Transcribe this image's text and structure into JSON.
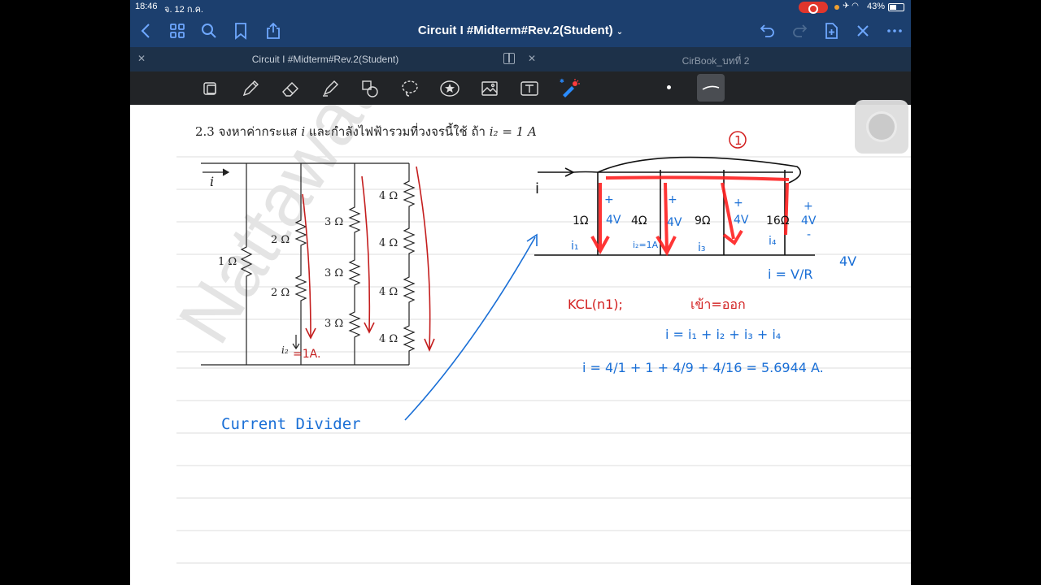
{
  "status_bar": {
    "time": "18:46",
    "date": "จ. 12 ก.ค.",
    "battery": "43%"
  },
  "nav": {
    "title": "Circuit I #Midterm#Rev.2(Student)",
    "icons": [
      "back-icon",
      "grid-icon",
      "search-icon",
      "bookmark-icon",
      "share-icon",
      "undo-icon",
      "redo-icon",
      "add-page-icon",
      "close-icon",
      "more-icon"
    ]
  },
  "tabs": [
    {
      "label": "Circuit I #Midterm#Rev.2(Student)",
      "active": true
    },
    {
      "label": "CirBook_บทที่ 2",
      "active": false
    }
  ],
  "toolbar": {
    "tools": [
      "read-mode-icon",
      "pen-icon",
      "eraser-icon",
      "highlighter-icon",
      "shapes-icon",
      "lasso-icon",
      "sticker-icon",
      "image-icon",
      "text-icon",
      "laser-pointer-icon"
    ],
    "selected_stroke": "thin-line"
  },
  "question": {
    "number": "2.3",
    "text": "จงหาค่ากระแส",
    "var_i": "i",
    "text2": "และกำลังไฟฟ้ารวมที่วงจรนี้ใช้ ถ้า",
    "condition": "i₂ = 1 A"
  },
  "circuit": {
    "input_current": "i",
    "resistors": [
      "1 Ω",
      "2 Ω",
      "2 Ω",
      "3 Ω",
      "3 Ω",
      "3 Ω",
      "4 Ω",
      "4 Ω",
      "4 Ω",
      "4 Ω"
    ],
    "branch_current": "i₂",
    "watermark": "Nattawat"
  },
  "handwriting": {
    "branch_annotation": "=1A.",
    "node_label": "1",
    "simplified_resistors": [
      "1Ω",
      "4Ω",
      "9Ω",
      "16Ω"
    ],
    "voltages": [
      "4V",
      "4V",
      "4V",
      "4V"
    ],
    "currents": [
      "i₁",
      "i₂=1A",
      "i₃",
      "i₄"
    ],
    "plus": "+",
    "minus": "-",
    "ohm_formula": "i = V/R",
    "v_value": "4V",
    "kcl": "KCL(n1);",
    "kcl_note": "เข้า=ออก",
    "kcl_eq": "i = i₁ + i₂ + i₃ + i₄",
    "final_eq": "i = 4/1 + 1 + 4/9 + 4/16 = 5.6944 A.",
    "method": "Current Divider"
  },
  "colors": {
    "nav": "#1c3f6e",
    "ink_blue": "#1a6fd6",
    "ink_red": "#d21f1f",
    "toolbar": "#222427"
  }
}
